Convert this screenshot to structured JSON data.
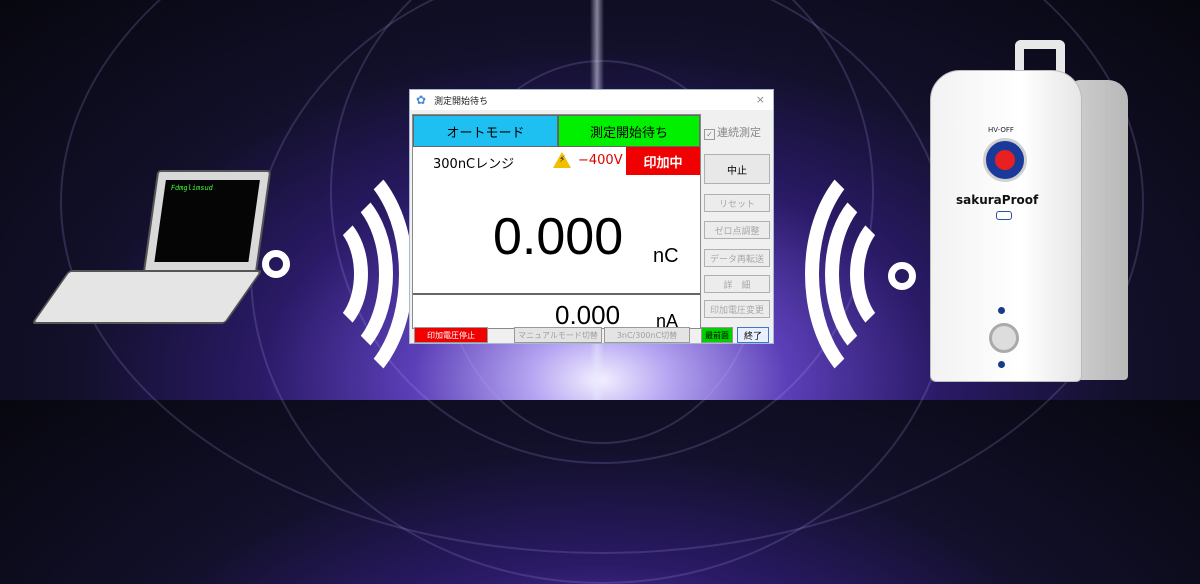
{
  "window": {
    "title": "測定開始待ち",
    "close_glyph": "×"
  },
  "display": {
    "mode": "オートモード",
    "status": "測定開始待ち",
    "range": "300nCレンジ",
    "voltage": "−400V",
    "applying_badge": "印加中",
    "main_value": "0.000",
    "main_unit": "nC",
    "sub_value": "0.000",
    "sub_unit": "nA"
  },
  "side": {
    "continuous_label": "連続測定",
    "stop_button": "中止",
    "reset_button": "リセット",
    "zero_adjust_button": "ゼロ点調整",
    "resend_button": "データ再転送",
    "detail_button": "詳　細",
    "voltage_change_button": "印加電圧変更"
  },
  "bottom": {
    "stop_voltage_button": "印加電圧停止",
    "manual_switch_button": "マニュアルモード切替",
    "range_switch_button": "3nC/300nC切替",
    "front_button": "最前面",
    "exit_button": "終了"
  },
  "laptop": {
    "screen_text": "Fdmglimsud"
  },
  "device": {
    "hv_label": "HV-OFF",
    "brand": "sakuraProof"
  },
  "colors": {
    "mode_cell": "#1ec0f2",
    "status_cell": "#00f000",
    "applying": "#f00000",
    "voltage": "#e00000"
  }
}
